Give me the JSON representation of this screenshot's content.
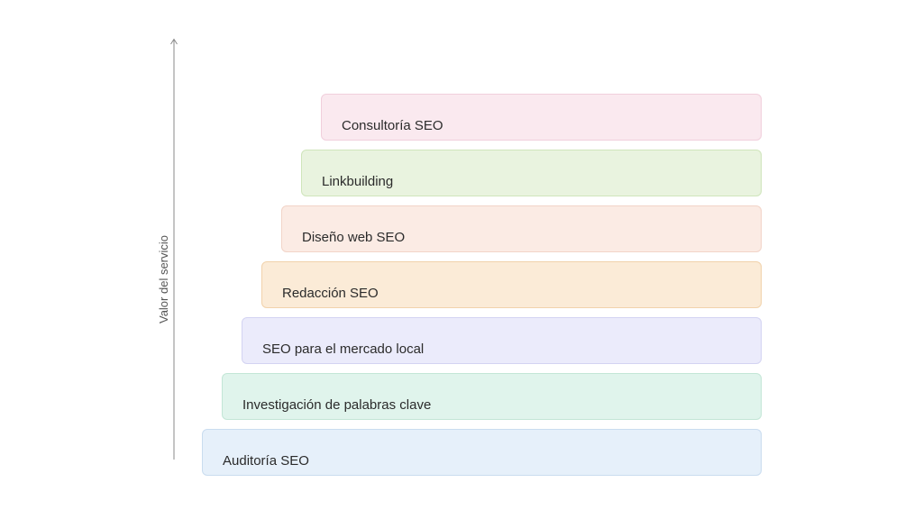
{
  "diagram": {
    "axis_label": "Valor del servicio",
    "steps": [
      {
        "label": "Auditoría SEO"
      },
      {
        "label": "Investigación de palabras clave"
      },
      {
        "label": "SEO para el mercado local"
      },
      {
        "label": "Redacción SEO"
      },
      {
        "label": "Diseño web SEO"
      },
      {
        "label": "Linkbuilding"
      },
      {
        "label": "Consultoría SEO"
      }
    ]
  }
}
